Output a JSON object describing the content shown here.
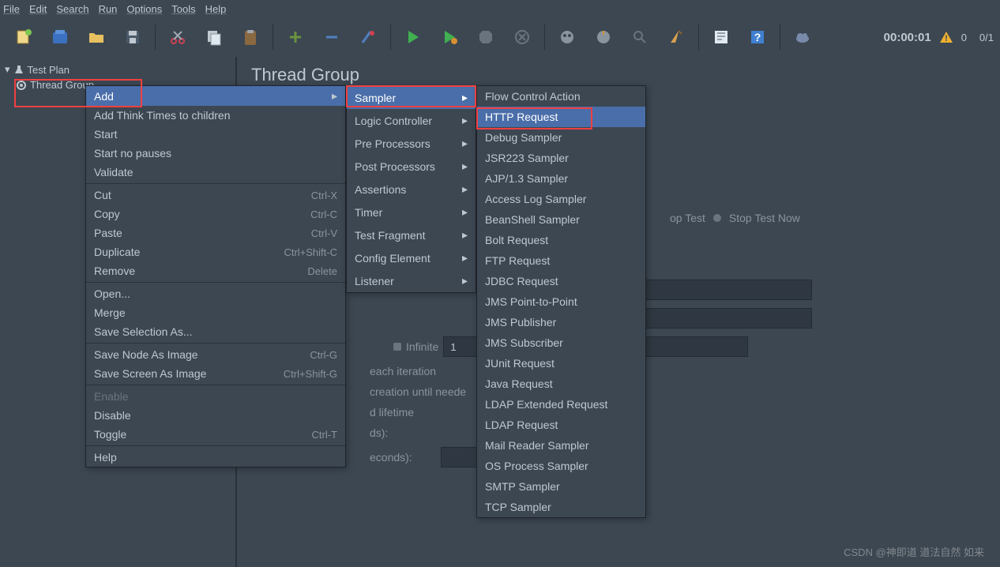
{
  "menubar": [
    "File",
    "Edit",
    "Search",
    "Run",
    "Options",
    "Tools",
    "Help"
  ],
  "toolbar_icons": [
    "new",
    "open-templates",
    "open",
    "save",
    "cut",
    "copy",
    "paste",
    "plus",
    "minus",
    "wrench",
    "start",
    "start-no-pauses",
    "stop",
    "shutdown",
    "clear",
    "clear-all",
    "search-tree",
    "function",
    "help",
    "heap",
    "cloud"
  ],
  "timer": "00:00:01",
  "warn_count": "0",
  "thread_count": "0/1",
  "tree": {
    "root": "Test Plan",
    "child": "Thread Group"
  },
  "content": {
    "title": "Thread Group",
    "stop_test": "op Test",
    "stop_now": "Stop Test Now",
    "infinite": "Infinite",
    "infinite_val": "1",
    "frag_each": "each iteration",
    "frag_creation": "creation until neede",
    "frag_lifetime": "d lifetime",
    "frag_ds": "ds):",
    "frag_seconds": "econds):"
  },
  "ctx1": [
    {
      "label": "Add",
      "selected": true,
      "arrow": true
    },
    {
      "label": "Add Think Times to children"
    },
    {
      "label": "Start"
    },
    {
      "label": "Start no pauses"
    },
    {
      "label": "Validate"
    },
    {
      "sep": true
    },
    {
      "label": "Cut",
      "shortcut": "Ctrl-X"
    },
    {
      "label": "Copy",
      "shortcut": "Ctrl-C"
    },
    {
      "label": "Paste",
      "shortcut": "Ctrl-V"
    },
    {
      "label": "Duplicate",
      "shortcut": "Ctrl+Shift-C"
    },
    {
      "label": "Remove",
      "shortcut": "Delete"
    },
    {
      "sep": true
    },
    {
      "label": "Open..."
    },
    {
      "label": "Merge"
    },
    {
      "label": "Save Selection As..."
    },
    {
      "sep": true
    },
    {
      "label": "Save Node As Image",
      "shortcut": "Ctrl-G"
    },
    {
      "label": "Save Screen As Image",
      "shortcut": "Ctrl+Shift-G"
    },
    {
      "sep": true
    },
    {
      "label": "Enable",
      "disabled": true
    },
    {
      "label": "Disable"
    },
    {
      "label": "Toggle",
      "shortcut": "Ctrl-T"
    },
    {
      "sep": true
    },
    {
      "label": "Help"
    }
  ],
  "ctx2": [
    {
      "label": "Sampler",
      "selected": true
    },
    {
      "label": "Logic Controller"
    },
    {
      "label": "Pre Processors"
    },
    {
      "label": "Post Processors"
    },
    {
      "label": "Assertions"
    },
    {
      "label": "Timer"
    },
    {
      "label": "Test Fragment"
    },
    {
      "label": "Config Element"
    },
    {
      "label": "Listener"
    }
  ],
  "ctx3": [
    {
      "label": "Flow Control Action"
    },
    {
      "label": "HTTP Request",
      "selected": true
    },
    {
      "label": "Debug Sampler"
    },
    {
      "label": "JSR223 Sampler"
    },
    {
      "label": "AJP/1.3 Sampler"
    },
    {
      "label": "Access Log Sampler"
    },
    {
      "label": "BeanShell Sampler"
    },
    {
      "label": "Bolt Request"
    },
    {
      "label": "FTP Request"
    },
    {
      "label": "JDBC Request"
    },
    {
      "label": "JMS Point-to-Point"
    },
    {
      "label": "JMS Publisher"
    },
    {
      "label": "JMS Subscriber"
    },
    {
      "label": "JUnit Request"
    },
    {
      "label": "Java Request"
    },
    {
      "label": "LDAP Extended Request"
    },
    {
      "label": "LDAP Request"
    },
    {
      "label": "Mail Reader Sampler"
    },
    {
      "label": "OS Process Sampler"
    },
    {
      "label": "SMTP Sampler"
    },
    {
      "label": "TCP Sampler"
    }
  ],
  "watermark": "CSDN @神即道 道法自然 如来"
}
